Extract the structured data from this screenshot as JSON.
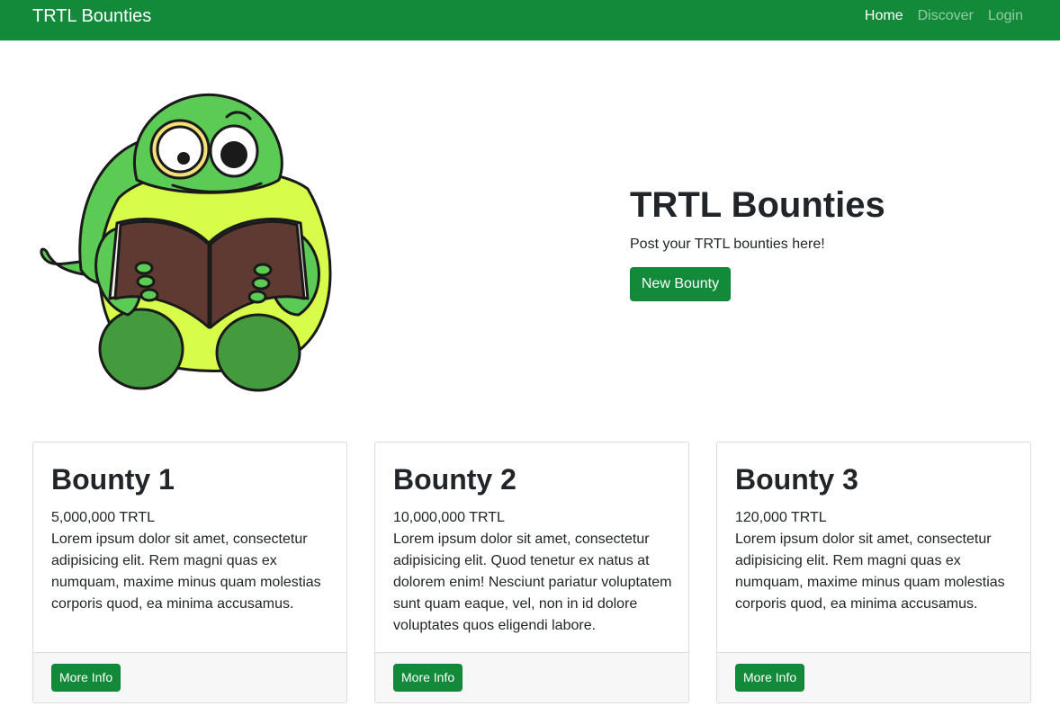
{
  "navbar": {
    "brand": "TRTL Bounties",
    "links": [
      {
        "label": "Home",
        "active": true
      },
      {
        "label": "Discover",
        "active": false
      },
      {
        "label": "Login",
        "active": false
      }
    ]
  },
  "hero": {
    "image_icon": "turtle-reading-book-illustration",
    "title": "TRTL Bounties",
    "subtitle": "Post your TRTL bounties here!",
    "button_label": "New Bounty"
  },
  "bounties": [
    {
      "title": "Bounty 1",
      "amount": "5,000,000 TRTL",
      "description": "Lorem ipsum dolor sit amet, consectetur adipisicing elit. Rem magni quas ex numquam, maxime minus quam molestias corporis quod, ea minima accusamus.",
      "button_label": "More Info"
    },
    {
      "title": "Bounty 2",
      "amount": "10,000,000 TRTL",
      "description": "Lorem ipsum dolor sit amet, consectetur adipisicing elit. Quod tenetur ex natus at dolorem enim! Nesciunt pariatur voluptatem sunt quam eaque, vel, non in id dolore voluptates quos eligendi labore.",
      "button_label": "More Info"
    },
    {
      "title": "Bounty 3",
      "amount": "120,000 TRTL",
      "description": "Lorem ipsum dolor sit amet, consectetur adipisicing elit. Rem magni quas ex numquam, maxime minus quam molestias corporis quod, ea minima accusamus.",
      "button_label": "More Info"
    }
  ],
  "colors": {
    "brand_green": "#138a3a",
    "turtle_green": "#5ccb55",
    "turtle_belly": "#d8fc4a",
    "book_brown": "#5f3a33"
  }
}
